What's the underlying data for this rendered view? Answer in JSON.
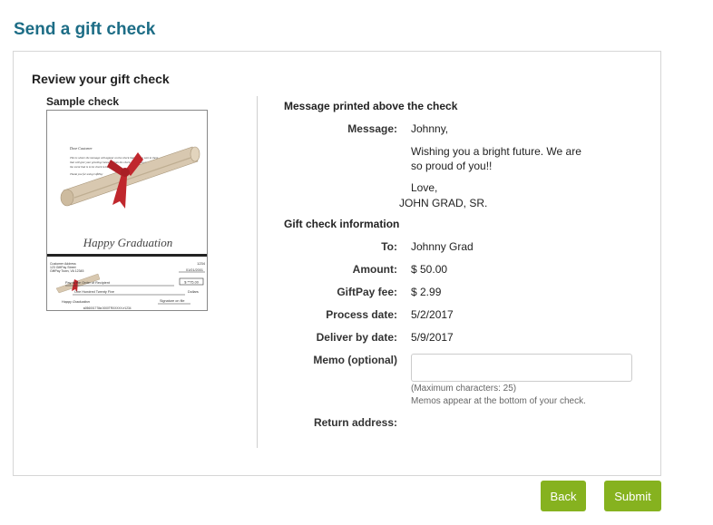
{
  "page": {
    "title": "Send a gift check"
  },
  "review": {
    "title": "Review your gift check"
  },
  "sample": {
    "label": "Sample check",
    "check": {
      "greeting": "Dear Customer",
      "body_lines": [
        "This is where the message will appear on the check that is to be sent to them",
        "that will give your greeting/ message from the check sender. You may also",
        "the event that is to be check to be the word.",
        "Thank you for using GiftPay"
      ],
      "occasion": "Happy Graduation",
      "address_lines": [
        "Customer Address",
        "123 GiftPay Street",
        "GiftPay Town, VA 12345"
      ],
      "check_number": "1234",
      "date": "01/01/2001",
      "payee": "Pay to the Order of Recipient",
      "amount_box": "$ **75.00",
      "amount_words": "One Hundred Twenty Five",
      "dollars_word": "Dollars",
      "memo_occasion": "Happy Graduation",
      "signature": "Signature on file",
      "micr": "⑆056001778⑆ 0000TRXXXXX ⑈1234"
    }
  },
  "message_section": {
    "heading": "Message printed above the check",
    "label": "Message:",
    "greeting": "Johnny,",
    "body_line1": "Wishing you a bright future. We are",
    "body_line2": "so proud of you!!",
    "closing": "Love,",
    "signature": "JOHN GRAD, SR."
  },
  "info_section": {
    "heading": "Gift check information",
    "to_label": "To:",
    "to_value": "Johnny Grad",
    "amount_label": "Amount:",
    "amount_value": "$ 50.00",
    "fee_label": "GiftPay fee:",
    "fee_value": "$ 2.99",
    "process_label": "Process date:",
    "process_value": "5/2/2017",
    "deliver_label": "Deliver by date:",
    "deliver_value": "5/9/2017",
    "memo_label": "Memo (optional)",
    "memo_value": "",
    "memo_hint1": "(Maximum characters: 25)",
    "memo_hint2": "Memos appear at the bottom of your check.",
    "return_label": "Return address:"
  },
  "buttons": {
    "back": "Back",
    "submit": "Submit"
  },
  "colors": {
    "title": "#1d6d86",
    "button": "#86b21f",
    "ribbon": "#c0272d"
  }
}
